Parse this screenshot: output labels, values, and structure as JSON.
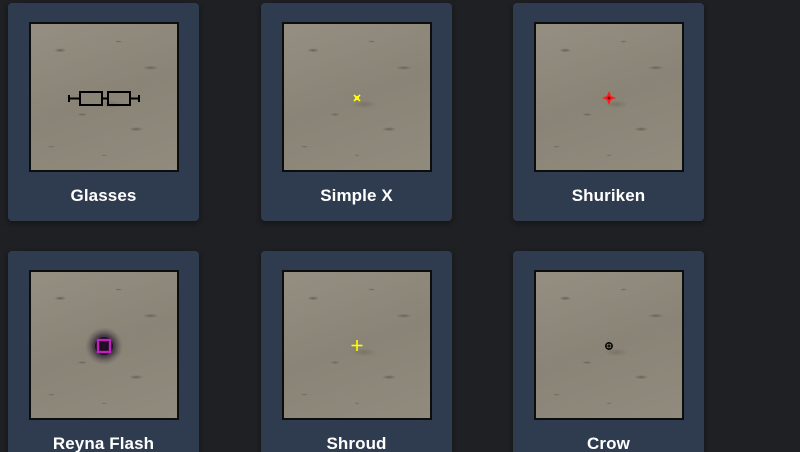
{
  "crosshairs": [
    {
      "name": "Glasses",
      "icon": "glasses-crosshair-icon",
      "color": "#000000"
    },
    {
      "name": "Simple X",
      "icon": "simple-x-crosshair-icon",
      "color": "#ffff00"
    },
    {
      "name": "Shuriken",
      "icon": "shuriken-crosshair-icon",
      "color": "#ff1a1a"
    },
    {
      "name": "Reyna Flash",
      "icon": "reyna-flash-crosshair-icon",
      "color": "#c020c0"
    },
    {
      "name": "Shroud",
      "icon": "shroud-crosshair-icon",
      "color": "#ffff00"
    },
    {
      "name": "Crow",
      "icon": "crow-crosshair-icon",
      "color": "#000000"
    }
  ]
}
